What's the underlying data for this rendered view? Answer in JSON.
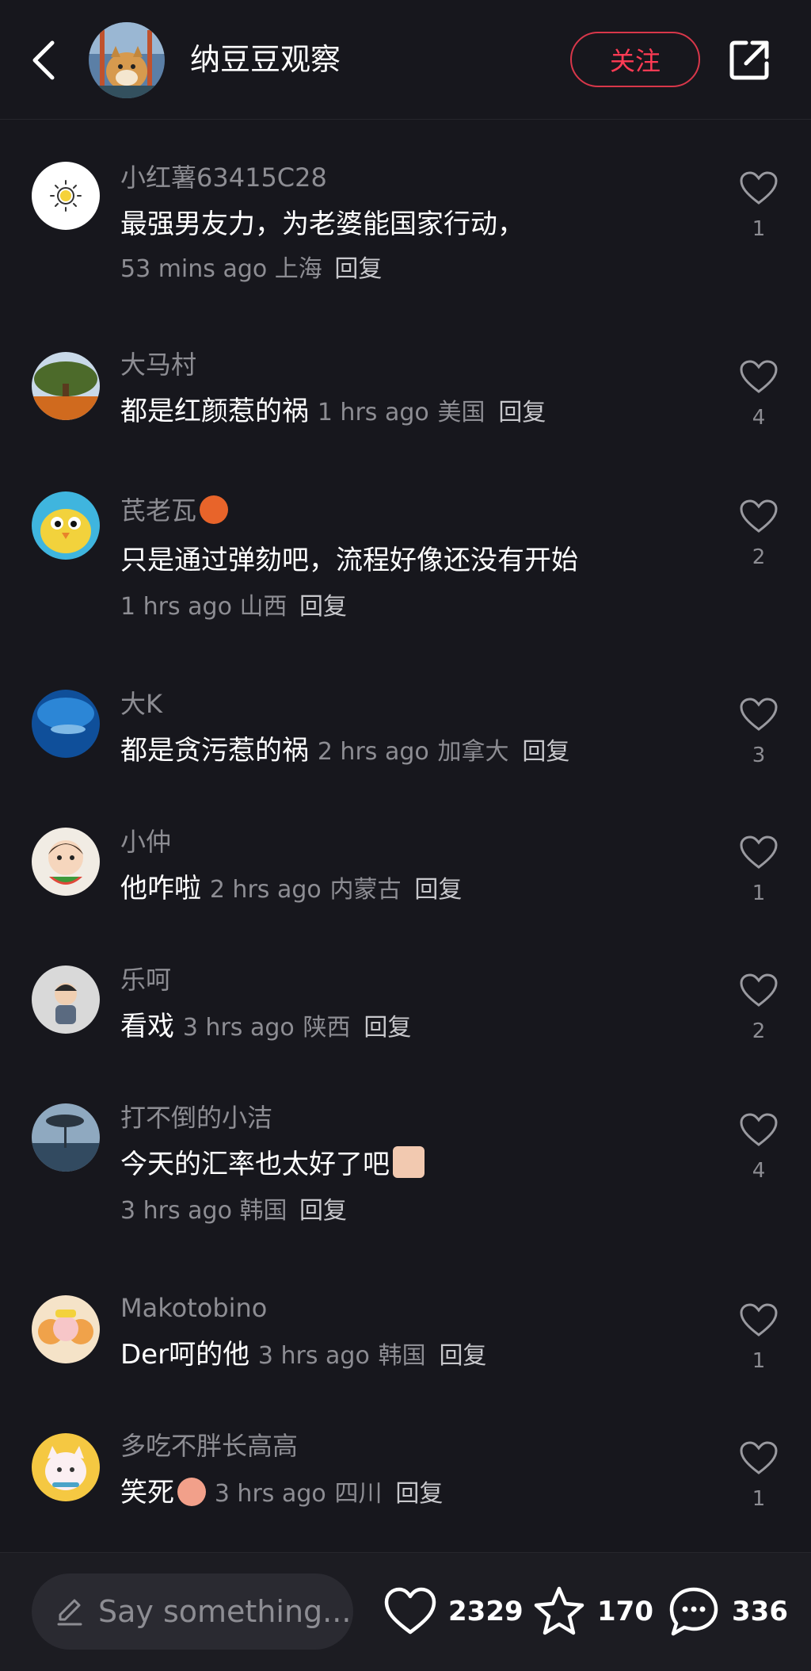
{
  "header": {
    "title": "纳豆豆观察",
    "follow_label": "关注"
  },
  "comments": [
    {
      "user": "小红薯63415C28",
      "text": "最强男友力，为老婆能国家行动，",
      "time": "53 mins ago",
      "location": "上海",
      "reply": "回复",
      "likes": "1",
      "avatar_color": "#ffffff"
    },
    {
      "user": "大马村",
      "text": "都是红颜惹的祸",
      "time": "1 hrs ago",
      "location": "美国",
      "reply": "回复",
      "likes": "4",
      "avatar_color": "#6b7a3a"
    },
    {
      "user": "芪老瓦",
      "text": "只是通过弹劾吧，流程好像还没有开始",
      "time": "1 hrs ago",
      "location": "山西",
      "reply": "回复",
      "likes": "2",
      "avatar_color": "#38b3d9"
    },
    {
      "user": "大K",
      "text": "都是贪污惹的祸",
      "time": "2 hrs ago",
      "location": "加拿大",
      "reply": "回复",
      "likes": "3",
      "avatar_color": "#1e6fb8"
    },
    {
      "user": "小仲",
      "text": "他咋啦",
      "time": "2 hrs ago",
      "location": "内蒙古",
      "reply": "回复",
      "likes": "1",
      "avatar_color": "#e9e2d6"
    },
    {
      "user": "乐呵",
      "text": "看戏",
      "time": "3 hrs ago",
      "location": "陕西",
      "reply": "回复",
      "likes": "2",
      "avatar_color": "#cfcfcf"
    },
    {
      "user": "打不倒的小洁",
      "text": "今天的汇率也太好了吧",
      "time": "3 hrs ago",
      "location": "韩国",
      "reply": "回复",
      "likes": "4",
      "avatar_color": "#4a6d8a"
    },
    {
      "user": "Makotobino",
      "text": "Der呵的他",
      "time": "3 hrs ago",
      "location": "韩国",
      "reply": "回复",
      "likes": "1",
      "avatar_color": "#f0a25a"
    },
    {
      "user": "多吃不胖长高高",
      "text": "笑死",
      "time": "3 hrs ago",
      "location": "四川",
      "reply": "回复",
      "likes": "1",
      "avatar_color": "#f5c842"
    }
  ],
  "bottom_bar": {
    "input_placeholder": "Say something...",
    "likes_count": "2329",
    "favorites_count": "170",
    "comments_count": "336"
  },
  "colors": {
    "background": "#17171d",
    "accent": "#ff3b54",
    "muted_text": "#8d8d93"
  },
  "icons": [
    "back-icon",
    "share-icon",
    "heart-icon",
    "star-icon",
    "comment-bubble-icon",
    "pencil-icon"
  ]
}
